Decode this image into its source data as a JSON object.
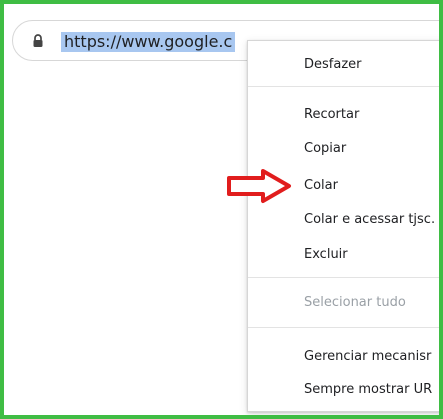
{
  "address_bar": {
    "url": "https://www.google.c",
    "icons": {
      "security": "lock-icon"
    }
  },
  "context_menu": {
    "items": {
      "undo": {
        "label": "Desfazer",
        "enabled": true
      },
      "cut": {
        "label": "Recortar",
        "enabled": true
      },
      "copy": {
        "label": "Copiar",
        "enabled": true
      },
      "paste": {
        "label": "Colar",
        "enabled": true
      },
      "paste_and_go": {
        "label": "Colar e acessar tjsc.",
        "enabled": true
      },
      "delete": {
        "label": "Excluir",
        "enabled": true
      },
      "select_all": {
        "label": "Selecionar tudo",
        "enabled": false
      },
      "manage_search_engines": {
        "label": "Gerenciar mecanisr",
        "enabled": true
      },
      "always_show_full_urls": {
        "label": "Sempre mostrar UR",
        "enabled": true
      }
    }
  },
  "annotation": {
    "icon": "red-right-arrow-icon",
    "color": "#e11d1d"
  },
  "colors": {
    "frame_border": "#3fbd44",
    "url_highlight": "#a8c7f0",
    "menu_text": "#202124",
    "menu_disabled_text": "#9aa0a6"
  }
}
